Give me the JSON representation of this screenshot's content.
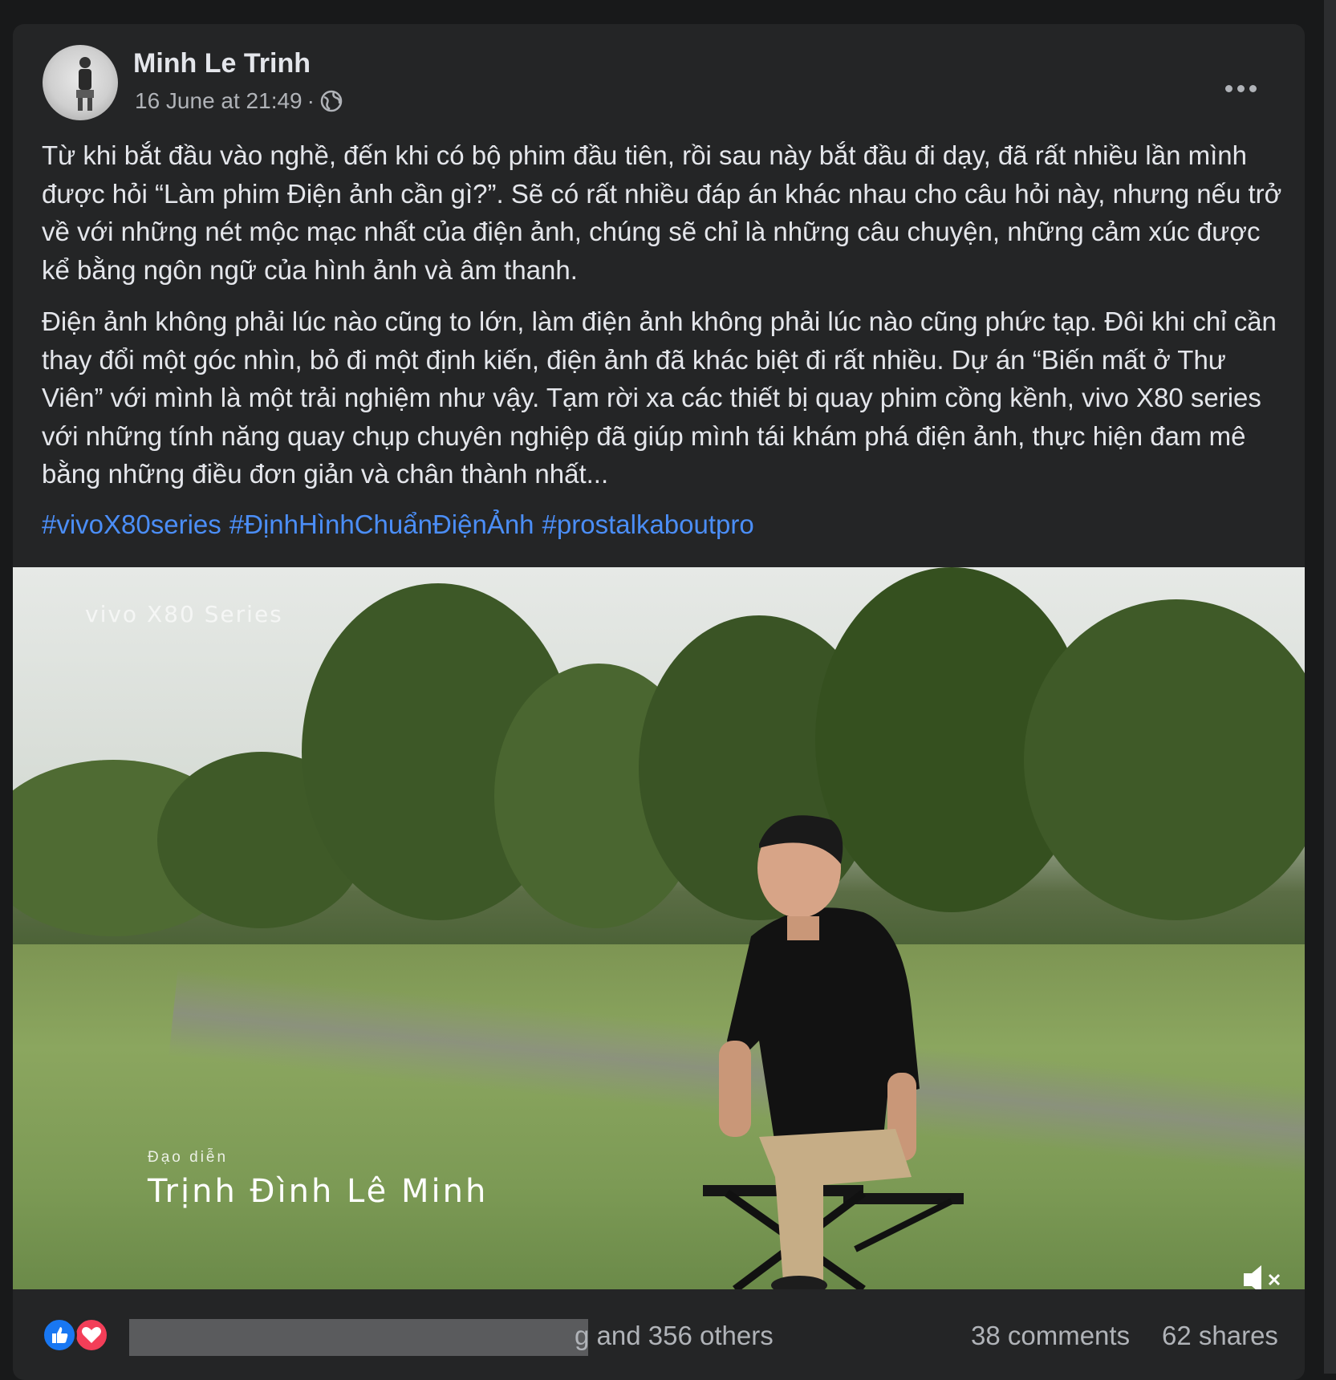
{
  "post": {
    "author": "Minh Le Trinh",
    "timestamp": "16 June at 21:49",
    "separator": "·",
    "privacy_icon": "globe-icon",
    "paragraphs": [
      "Từ khi bắt đầu vào nghề, đến khi có bộ phim đầu tiên, rồi sau này bắt đầu đi dạy, đã rất nhiều lần mình được hỏi “Làm phim Điện ảnh cần gì?”. Sẽ có rất nhiều đáp án khác nhau cho câu hỏi này, nhưng nếu trở về với những nét mộc mạc nhất của điện ảnh, chúng sẽ chỉ là những câu chuyện, những cảm xúc được kể bằng ngôn ngữ của hình ảnh và âm thanh.",
      "Điện ảnh không phải lúc nào cũng to lớn, làm điện ảnh không phải lúc nào cũng phức tạp. Đôi khi chỉ cần thay đổi một góc nhìn, bỏ đi một định kiến, điện ảnh đã khác biệt đi rất nhiều. Dự án “Biến mất ở Thư Viên” với mình là một trải nghiệm như vậy. Tạm rời xa các thiết bị quay phim cồng kềnh, vivo X80 series với những tính năng quay chụp chuyên nghiệp đã giúp mình tái khám phá điện ảnh, thực hiện đam mê bằng những điều đơn giản và chân thành nhất..."
    ],
    "hashtags": [
      "#vivoX80series",
      "#ĐịnhHìnhChuẩnĐiệnẢnh",
      "#prostalkaboutpro"
    ]
  },
  "video": {
    "watermark": "vivo X80 Series",
    "caption_label": "Đạo diễn",
    "caption_name": "Trịnh Đình Lê Minh",
    "mute_icon": "speaker-muted-icon"
  },
  "footer": {
    "reactions_text": "g and 356 others",
    "comments": "38 comments",
    "shares": "62 shares"
  },
  "colors": {
    "background": "#18191a",
    "card": "#242526",
    "text_primary": "#e4e6eb",
    "text_secondary": "#b0b3b8",
    "hashtag": "#4b8ef7",
    "like_blue": "#1877f2",
    "love_red": "#f33e58"
  }
}
